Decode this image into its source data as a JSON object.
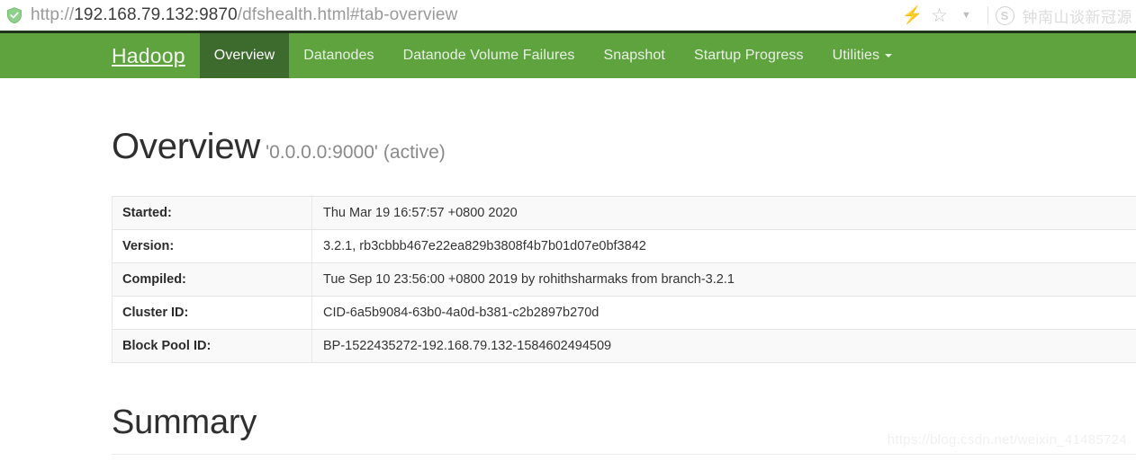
{
  "browser": {
    "security_icon": "shield-check-icon",
    "url_prefix": "http://",
    "url_host": "192.168.79.132:9870",
    "url_path": "/dfshealth.html#tab-overview",
    "url_full": "http://192.168.79.132:9870/dfshealth.html#tab-overview",
    "toolbar": {
      "bolt_icon": "lightning-bolt-icon",
      "bookmark_icon": "star-icon",
      "menu_icon": "chevron-down-icon",
      "extension_icon": "skype-icon",
      "extension_glyph": "S",
      "extension_label": "钟南山谈新冠源"
    }
  },
  "navbar": {
    "brand": "Hadoop",
    "brand_color": "#f2f7f0",
    "background_color": "#5fa33f",
    "active_background_color": "#3d6b2e",
    "items": [
      {
        "label": "Overview",
        "active": true
      },
      {
        "label": "Datanodes",
        "active": false
      },
      {
        "label": "Datanode Volume Failures",
        "active": false
      },
      {
        "label": "Snapshot",
        "active": false
      },
      {
        "label": "Startup Progress",
        "active": false
      },
      {
        "label": "Utilities",
        "active": false,
        "has_dropdown": true
      }
    ]
  },
  "overview": {
    "title": "Overview",
    "address": "'0.0.0.0:9000'",
    "state": "(active)",
    "rows": [
      {
        "label": "Started:",
        "value": "Thu Mar 19 16:57:57 +0800 2020"
      },
      {
        "label": "Version:",
        "value": "3.2.1, rb3cbbb467e22ea829b3808f4b7b01d07e0bf3842"
      },
      {
        "label": "Compiled:",
        "value": "Tue Sep 10 23:56:00 +0800 2019 by rohithsharmaks from branch-3.2.1"
      },
      {
        "label": "Cluster ID:",
        "value": "CID-6a5b9084-63b0-4a0d-b381-c2b2897b270d"
      },
      {
        "label": "Block Pool ID:",
        "value": "BP-1522435272-192.168.79.132-1584602494509"
      }
    ]
  },
  "summary": {
    "title": "Summary"
  },
  "watermark": {
    "text": "https://blog.csdn.net/weixin_41485724"
  }
}
